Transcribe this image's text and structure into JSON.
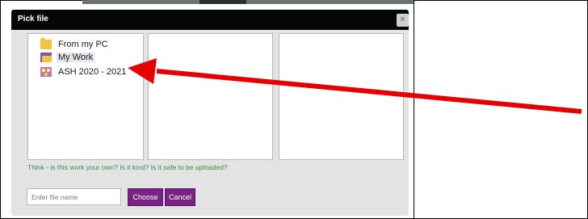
{
  "dialog": {
    "title": "Pick file",
    "close_label": "×",
    "files": [
      {
        "label": "From my PC",
        "icon": "folder-icon"
      },
      {
        "label": "My Work",
        "icon": "my-work-folder-icon"
      },
      {
        "label": "ASH 2020 - 2021",
        "icon": "group-icon"
      }
    ],
    "hint": "Think - is this work your own? Is it kind? Is it safe to be uploaded?",
    "filename_placeholder": "Enter file name",
    "choose_label": "Choose",
    "cancel_label": "Cancel"
  },
  "colors": {
    "header": "#060606",
    "button": "#7a2384",
    "hint_text": "#3a8a4a",
    "annotation_arrow": "#e60000"
  }
}
